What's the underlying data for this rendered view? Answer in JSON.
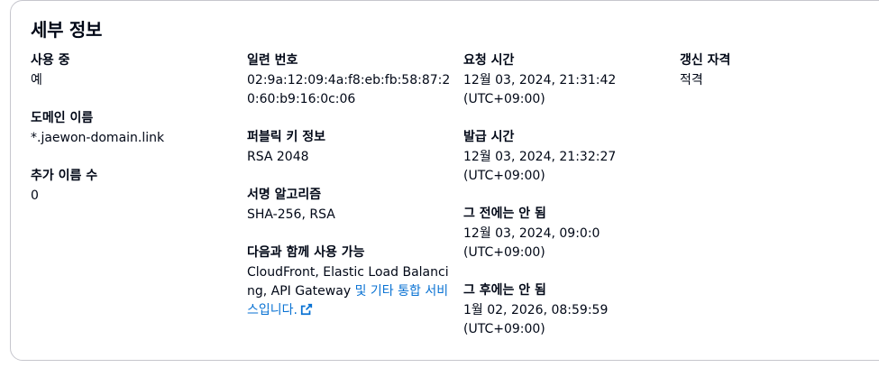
{
  "title": "세부 정보",
  "fields": {
    "in_use": {
      "label": "사용 중",
      "value": "예"
    },
    "domain_name": {
      "label": "도메인 이름",
      "value": "*.jaewon-domain.link"
    },
    "additional_names": {
      "label": "추가 이름 수",
      "value": "0"
    },
    "serial_number": {
      "label": "일련 번호",
      "value": "02:9a:12:09:4a:f8:eb:fb:58:87:20:60:b9:16:0c:06"
    },
    "public_key": {
      "label": "퍼블릭 키 정보",
      "value": "RSA 2048"
    },
    "signature_algorithm": {
      "label": "서명 알고리즘",
      "value": "SHA-256, RSA"
    },
    "can_be_used_with": {
      "label": "다음과 함께 사용 가능",
      "value": "CloudFront, Elastic Load Balancing, API Gateway ",
      "link_text": "및 기타 통합 서비스입니다."
    },
    "requested_at": {
      "label": "요청 시간",
      "value_line1": "12월 03, 2024, 21:31:42",
      "value_line2": "(UTC+09:00)"
    },
    "issued_at": {
      "label": "발급 시간",
      "value_line1": "12월 03, 2024, 21:32:27",
      "value_line2": "(UTC+09:00)"
    },
    "not_before": {
      "label": "그 전에는 안 됨",
      "value_line1": "12월 03, 2024, 09:0:0",
      "value_line2": "(UTC+09:00)"
    },
    "not_after": {
      "label": "그 후에는 안 됨",
      "value_line1": "1월 02, 2026, 08:59:59",
      "value_line2": "(UTC+09:00)"
    },
    "renewal_eligibility": {
      "label": "갱신 자격",
      "value": "적격"
    }
  },
  "icons": {
    "external_link": "external-link-icon"
  },
  "colors": {
    "link": "#0972d3",
    "text": "#000716",
    "border": "#c6c6cd"
  }
}
